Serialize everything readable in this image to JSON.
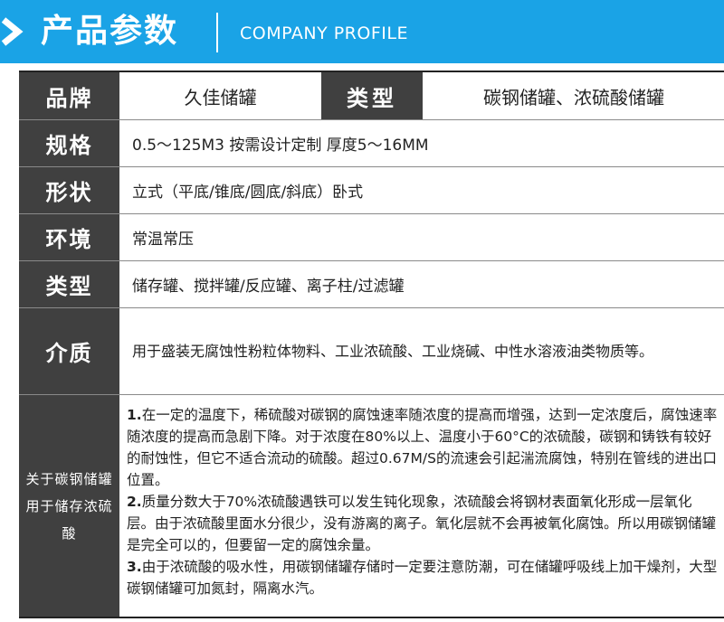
{
  "header": {
    "title_cn": "产品参数",
    "title_en": "COMPANY PROFILE",
    "accent_color": "#1aa3e6",
    "chevron_icon": "chevron-right-icon"
  },
  "params": {
    "brand_label": "品牌",
    "brand_value": "久佳储罐",
    "type_label": "类型",
    "type_value": "碳钢储罐、浓硫酸储罐",
    "spec_label": "规格",
    "spec_value": "0.5～125M3 按需设计定制  厚度5～16MM",
    "shape_label": "形状",
    "shape_value": "立式（平底/锥底/圆底/斜底）卧式",
    "env_label": "环境",
    "env_value": "常温常压",
    "kind_label": "类型",
    "kind_value": "储存罐、搅拌罐/反应罐、离子柱/过滤罐",
    "medium_label": "介质",
    "medium_value": "用于盛装无腐蚀性粉粒体物料、工业浓硫酸、工业烧碱、中性水溶液油类物质等。",
    "notes_label": "关于碳钢储罐用于储存浓硫酸",
    "notes": [
      {
        "num": "1.",
        "text": "在一定的温度下，稀硫酸对碳钢的腐蚀速率随浓度的提高而增强，达到一定浓度后，腐蚀速率随浓度的提高而急剧下降。对于浓度在80%以上、温度小于60°C的浓硫酸，碳钢和铸铁有较好的耐蚀性，但它不适合流动的硫酸。超过0.67M/S的流速会引起湍流腐蚀，特别在管线的进出口位置。"
      },
      {
        "num": "2.",
        "text": "质量分数大于70%浓硫酸遇铁可以发生钝化现象，浓硫酸会将钢材表面氧化形成一层氧化层。由于浓硫酸里面水分很少，没有游离的离子。氧化层就不会再被氧化腐蚀。所以用碳钢储罐是完全可以的，但要留一定的腐蚀余量。"
      },
      {
        "num": "3.",
        "text": "由于浓硫酸的吸水性，用碳钢储罐存储时一定要注意防潮，可在储罐呼吸线上加干燥剂，大型碳钢储罐可加氮封，隔离水汽。"
      }
    ]
  }
}
